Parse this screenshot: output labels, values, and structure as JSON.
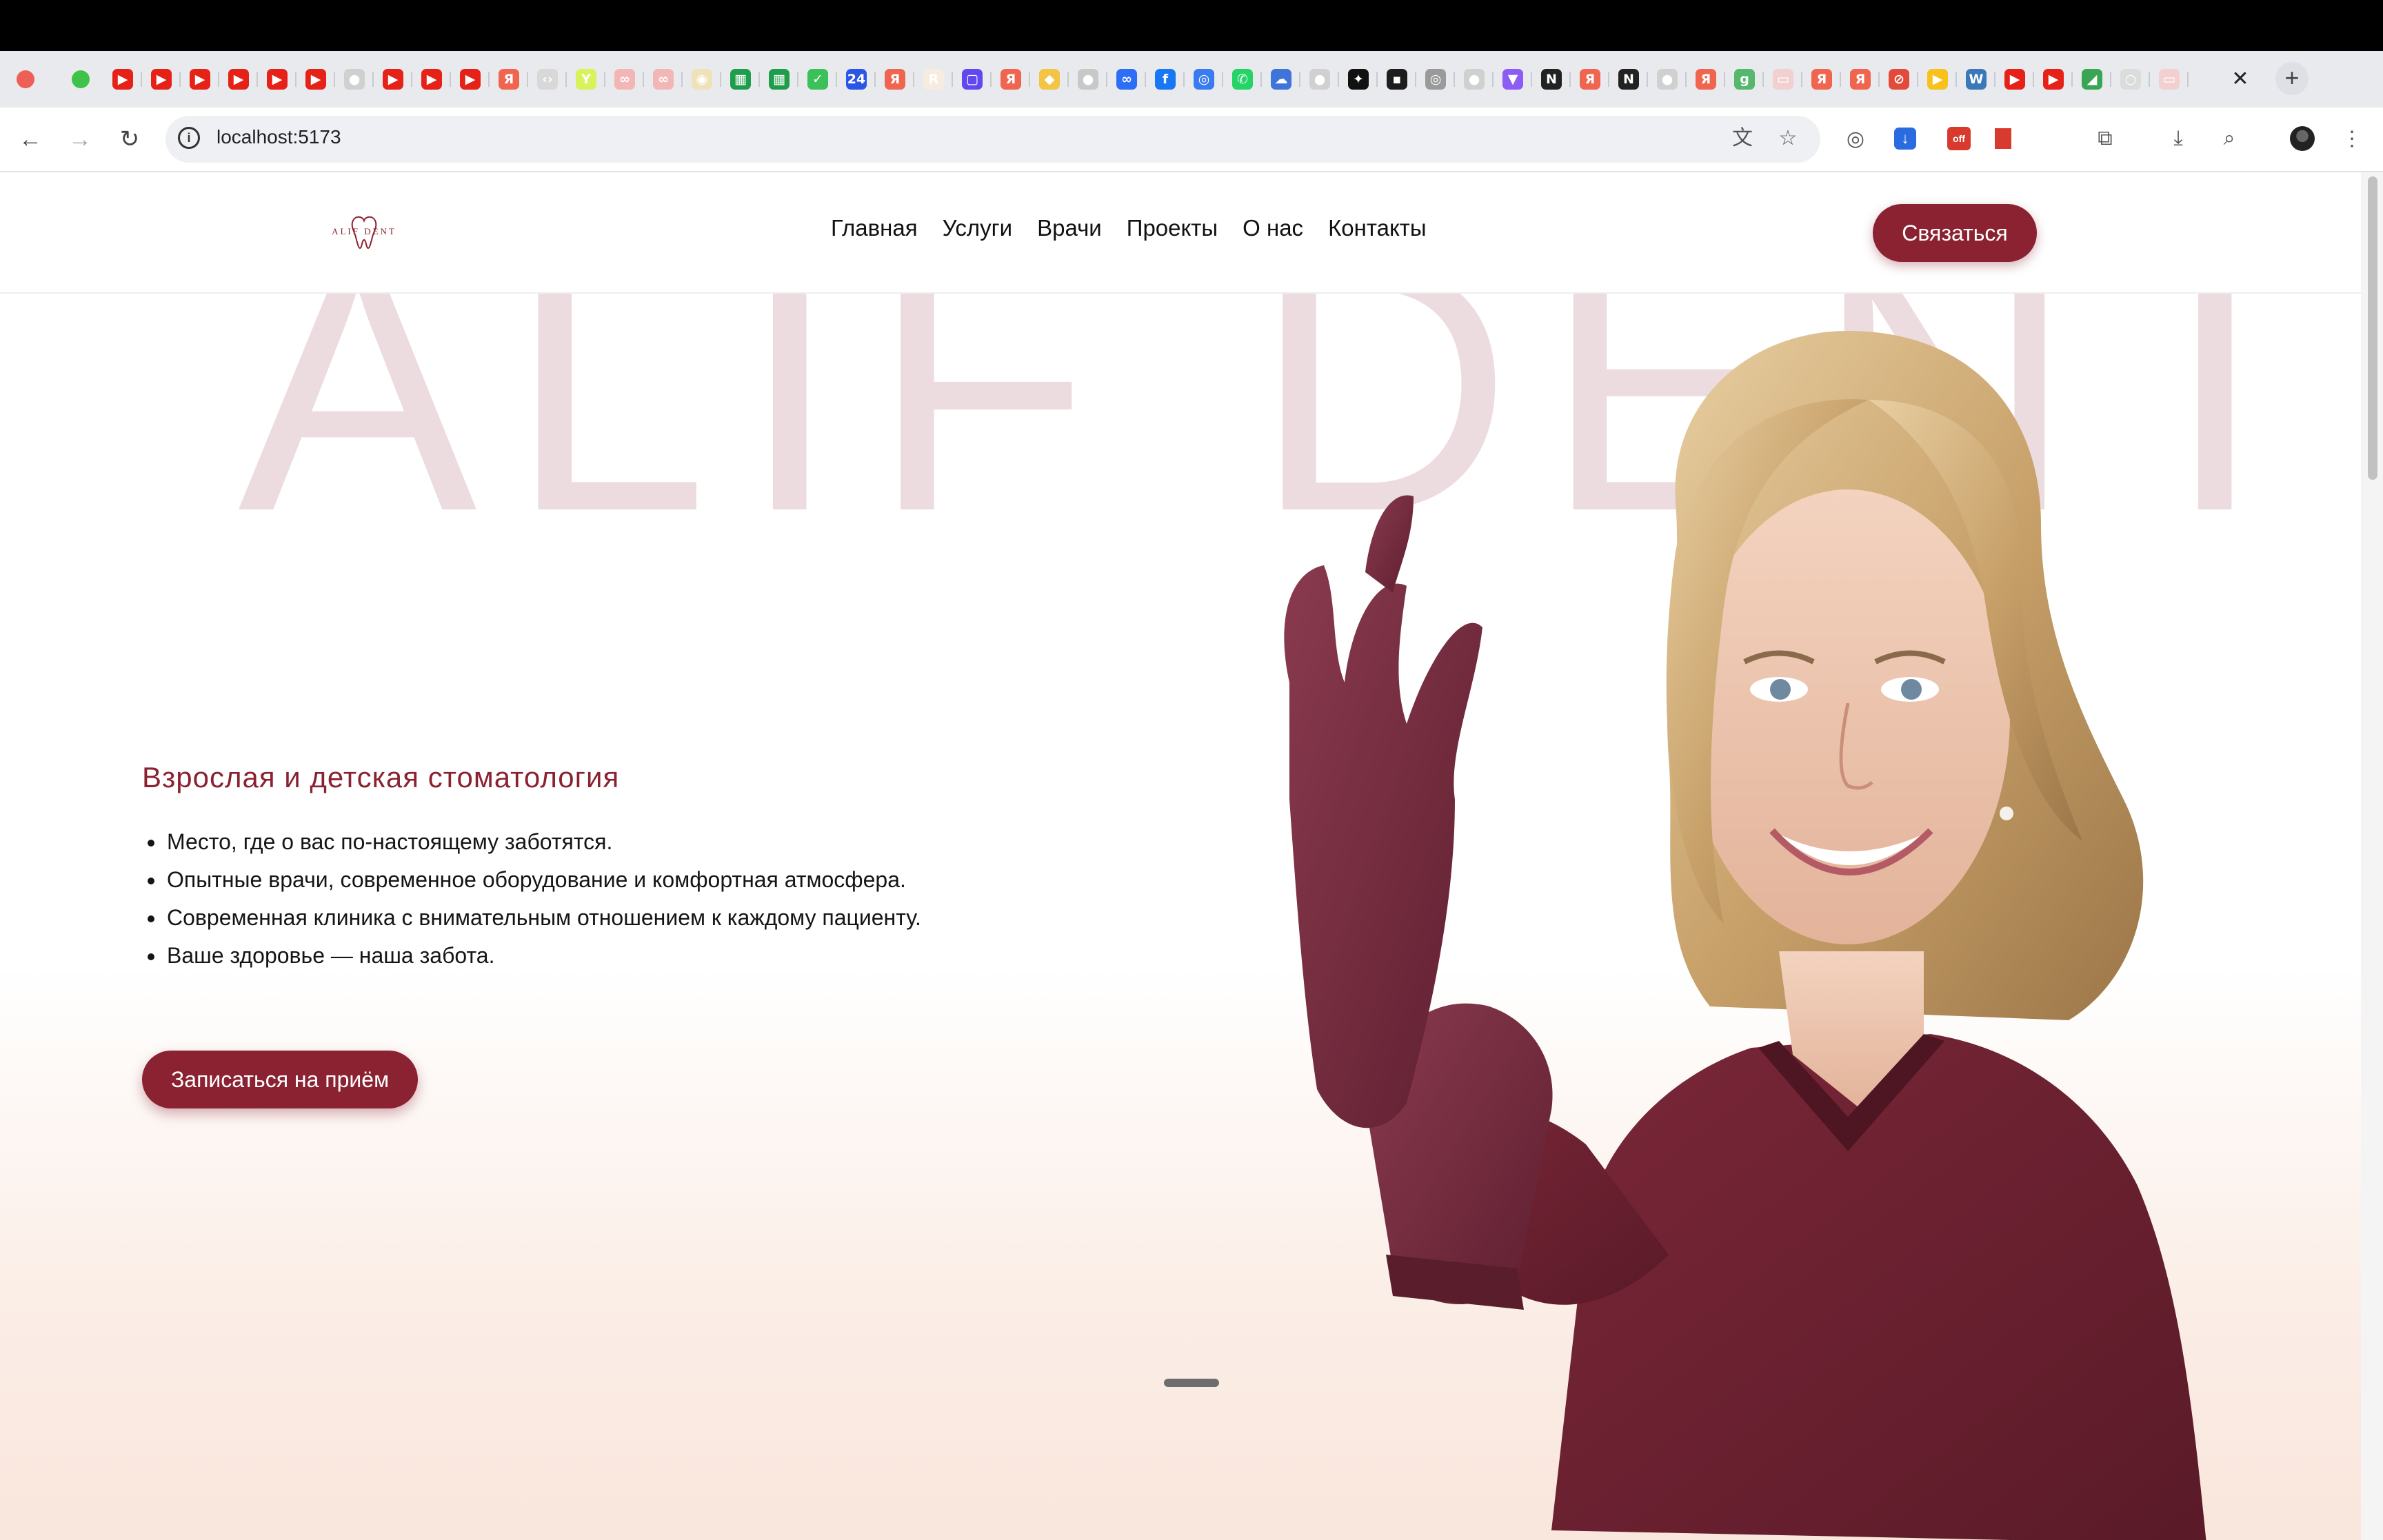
{
  "browser": {
    "url": "localhost:5173",
    "tab_close": "✕",
    "new_tab": "+",
    "favicons": [
      {
        "icon": "youtube-icon",
        "color": "#e62117",
        "glyph": "▶"
      },
      {
        "icon": "youtube-icon",
        "color": "#e62117",
        "glyph": "▶"
      },
      {
        "icon": "youtube-icon",
        "color": "#e62117",
        "glyph": "▶"
      },
      {
        "icon": "youtube-icon",
        "color": "#e62117",
        "glyph": "▶"
      },
      {
        "icon": "youtube-icon",
        "color": "#e62117",
        "glyph": "▶"
      },
      {
        "icon": "youtube-icon",
        "color": "#e62117",
        "glyph": "▶"
      },
      {
        "icon": "github-icon",
        "color": "#d0d0d0",
        "glyph": "●"
      },
      {
        "icon": "youtube-icon",
        "color": "#e62117",
        "glyph": "▶"
      },
      {
        "icon": "youtube-icon",
        "color": "#e62117",
        "glyph": "▶"
      },
      {
        "icon": "youtube-icon",
        "color": "#e62117",
        "glyph": "▶"
      },
      {
        "icon": "yandex-icon",
        "color": "#f0654f",
        "glyph": "Я"
      },
      {
        "icon": "code-icon",
        "color": "#d8d8d8",
        "glyph": "‹›"
      },
      {
        "icon": "y-icon",
        "color": "#d7f25a",
        "glyph": "Y"
      },
      {
        "icon": "flow-icon",
        "color": "#f2b6b6",
        "glyph": "∞"
      },
      {
        "icon": "flow-icon",
        "color": "#f2b6b6",
        "glyph": "∞"
      },
      {
        "icon": "bulb-icon",
        "color": "#f0e2b8",
        "glyph": "◉"
      },
      {
        "icon": "sheets-icon",
        "color": "#1e9e4a",
        "glyph": "▦"
      },
      {
        "icon": "sheets-icon",
        "color": "#1e9e4a",
        "glyph": "▦"
      },
      {
        "icon": "check-icon",
        "color": "#3cc05a",
        "glyph": "✓"
      },
      {
        "icon": "calendar-24-icon",
        "color": "#2a55e6",
        "glyph": "24"
      },
      {
        "icon": "yandex-icon",
        "color": "#f0654f",
        "glyph": "Я"
      },
      {
        "icon": "r-icon",
        "color": "#f6ece0",
        "glyph": "R"
      },
      {
        "icon": "chat-icon",
        "color": "#6147f0",
        "glyph": "▢"
      },
      {
        "icon": "yandex-icon",
        "color": "#f0654f",
        "glyph": "Я"
      },
      {
        "icon": "binance-icon",
        "color": "#f3c445",
        "glyph": "◆"
      },
      {
        "icon": "apple-icon",
        "color": "#c8c8c8",
        "glyph": "●"
      },
      {
        "icon": "meta-icon",
        "color": "#2d6ef7",
        "glyph": "∞"
      },
      {
        "icon": "facebook-icon",
        "color": "#1877f2",
        "glyph": "f"
      },
      {
        "icon": "globe-icon",
        "color": "#3a7bf0",
        "glyph": "◎"
      },
      {
        "icon": "whatsapp-icon",
        "color": "#25d366",
        "glyph": "✆"
      },
      {
        "icon": "cloud-icon",
        "color": "#3f74d8",
        "glyph": "☁"
      },
      {
        "icon": "github-icon",
        "color": "#d0d0d0",
        "glyph": "●"
      },
      {
        "icon": "openai-icon",
        "color": "#111111",
        "glyph": "✦"
      },
      {
        "icon": "terminal-icon",
        "color": "#1d1d1d",
        "glyph": "▪"
      },
      {
        "icon": "globe-icon",
        "color": "#9a9a9a",
        "glyph": "◎"
      },
      {
        "icon": "github-icon",
        "color": "#d0d0d0",
        "glyph": "●"
      },
      {
        "icon": "vite-icon",
        "color": "#8c5cf5",
        "glyph": "▼"
      },
      {
        "icon": "notion-icon",
        "color": "#222222",
        "glyph": "N"
      },
      {
        "icon": "yandex-icon",
        "color": "#f0654f",
        "glyph": "Я"
      },
      {
        "icon": "notion-icon",
        "color": "#222222",
        "glyph": "N"
      },
      {
        "icon": "github-icon",
        "color": "#d0d0d0",
        "glyph": "●"
      },
      {
        "icon": "yandex-icon",
        "color": "#f0654f",
        "glyph": "Я"
      },
      {
        "icon": "g-icon",
        "color": "#55b86c",
        "glyph": "g"
      },
      {
        "icon": "site-icon",
        "color": "#f3d0d0",
        "glyph": "▭"
      },
      {
        "icon": "yandex-icon",
        "color": "#f0654f",
        "glyph": "Я"
      },
      {
        "icon": "yandex-icon",
        "color": "#f0654f",
        "glyph": "Я"
      },
      {
        "icon": "ban-icon",
        "color": "#e24a3b",
        "glyph": "⊘"
      },
      {
        "icon": "play-icon",
        "color": "#f7c21b",
        "glyph": "▶"
      },
      {
        "icon": "wordpress-icon",
        "color": "#3a78b9",
        "glyph": "W"
      },
      {
        "icon": "youtube-icon",
        "color": "#e62117",
        "glyph": "▶"
      },
      {
        "icon": "youtube-icon",
        "color": "#e62117",
        "glyph": "▶"
      },
      {
        "icon": "chart-icon",
        "color": "#3aa655",
        "glyph": "◢"
      },
      {
        "icon": "blank-icon",
        "color": "#dcdcdc",
        "glyph": "○"
      },
      {
        "icon": "site-icon",
        "color": "#f3d0d0",
        "glyph": "▭"
      }
    ]
  },
  "site": {
    "logo_text": "ALIF DENT",
    "nav": [
      "Главная",
      "Услуги",
      "Врачи",
      "Проекты",
      "О нас",
      "Контакты"
    ],
    "cta": "Связаться",
    "bg_word": "ALIF DENT",
    "hero": {
      "title": "Взрослая и детская стоматология",
      "bullets": [
        "Место, где о вас по-настоящему заботятся.",
        "Опытные врачи, современное оборудование и комфортная атмосфера.",
        "Современная клиника с внимательным отношением к каждому пациенту.",
        "Ваше здоровье — наша забота."
      ],
      "button": "Записаться на приём"
    },
    "colors": {
      "brand": "#8a2231",
      "bg_word": "#ecdcdf",
      "scrubs": "#6e2231"
    }
  }
}
